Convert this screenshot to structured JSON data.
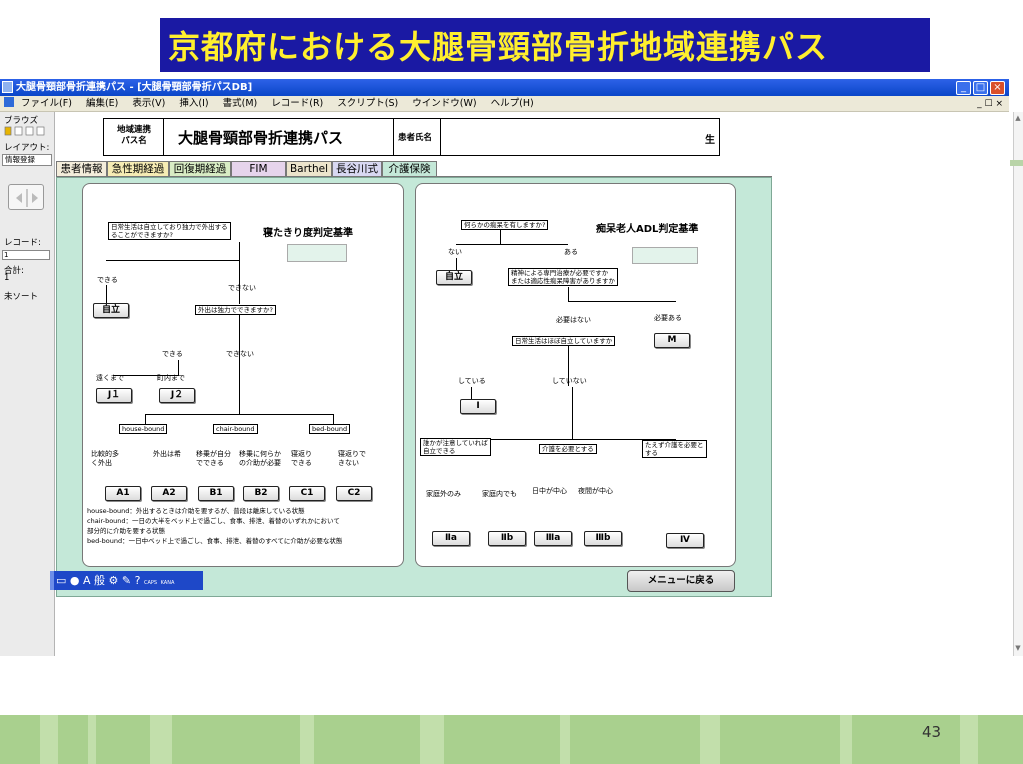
{
  "slide": {
    "title": "京都府における大腿骨頸部骨折地域連携パス",
    "page_number": "43"
  },
  "window": {
    "title": "大腿骨頸部骨折連携パス - [大腿骨頸部骨折パスDB]",
    "controls": {
      "minimize": "_",
      "maximize": "□",
      "close": "×"
    },
    "doc_controls": "_ ☐ ×"
  },
  "menu": [
    "ファイル(F)",
    "編集(E)",
    "表示(V)",
    "挿入(I)",
    "書式(M)",
    "レコード(R)",
    "スクリプト(S)",
    "ウインドウ(W)",
    "ヘルプ(H)"
  ],
  "status_panel": {
    "browse": "ブラウズ",
    "layout_label": "レイアウト:",
    "layout_value": "情報登録",
    "record_label": "レコード:",
    "record_value": "1",
    "total_label": "合計:",
    "total_value": "1",
    "sort": "未ソート"
  },
  "header": {
    "path_label": "地域連携\nパス名",
    "path_name": "大腿骨頸部骨折連携パス",
    "patient_label": "患者氏名",
    "sei": "生"
  },
  "tabs": [
    "患者情報",
    "急性期経過",
    "回復期経過",
    "FIM",
    "Barthel",
    "長谷川式",
    "介護保険"
  ],
  "left_chart": {
    "heading": "寝たきり度判定基準",
    "q1": "日常生活は自立しており独力で外出する\nることができますか?",
    "yes": "できる",
    "no": "できない",
    "result_independent": "自立",
    "q2": "外出は独力でできますか?",
    "q2_yes": "できる",
    "q2_no": "できない",
    "far": "遠くまで",
    "near": "町内まで",
    "j1": "J１",
    "j2": "J２",
    "house": "house-bound",
    "chair": "chair-bound",
    "bed": "bed-bound",
    "a1_text": "比較的多\nく外出",
    "a2_text": "外出は希",
    "b1_text": "移乗が自分\nでできる",
    "b2_text": "移乗に何らか\nの介助が必要",
    "c1_text": "寝返り\nできる",
    "c2_text": "寝返りで\nきない",
    "a1": "A1",
    "a2": "A2",
    "b1": "B1",
    "b2": "B2",
    "c1": "C1",
    "c2": "C2",
    "notes": [
      "house-bound：外出するときは介助を要するが、普段は離床している状態",
      "chair-bound：一日の大半をベッド上で過ごし、食事、排泄、着替のいずれかにおいて",
      "部分的に介助を要する状態",
      "bed-bound：一日中ベッド上で過ごし、食事、排泄、着替のすべてに介助が必要な状態"
    ]
  },
  "right_chart": {
    "heading": "痴呆老人ADL判定基準",
    "q1": "何らかの痴呆を有しますか?",
    "none": "ない",
    "exists": "ある",
    "result_independent": "自立",
    "q2": "精神による専門治療が必要ですか\nまたは適応性痴呆障害がありますか",
    "not_needed": "必要はない",
    "needed": "必要ある",
    "m": "M",
    "q3": "日常生活はほぼ自立していますか",
    "doing": "している",
    "not_doing": "していない",
    "r1": "I",
    "q4": "誰かが注意していれば\n自立できる",
    "q5": "介護を必要とする",
    "q6": "たえず介護を必要と\nする",
    "outside": "家庭外のみ",
    "inside": "家庭内でも",
    "daytime": "日中が中心",
    "night": "夜間が中心",
    "r2a": "Ⅱa",
    "r2b": "Ⅱb",
    "r3a": "Ⅲa",
    "r3b": "Ⅲb",
    "r4": "Ⅳ"
  },
  "menu_return": "メニューに戻る",
  "imebar": {
    "mode": "A 般",
    "caps": "CAPS",
    "kana": "KANA"
  },
  "colors": {
    "title_bg": "#1a19a3",
    "title_text": "#ffef2e",
    "content_bg": "#c4e8d8",
    "footer": "#a9d08e"
  }
}
